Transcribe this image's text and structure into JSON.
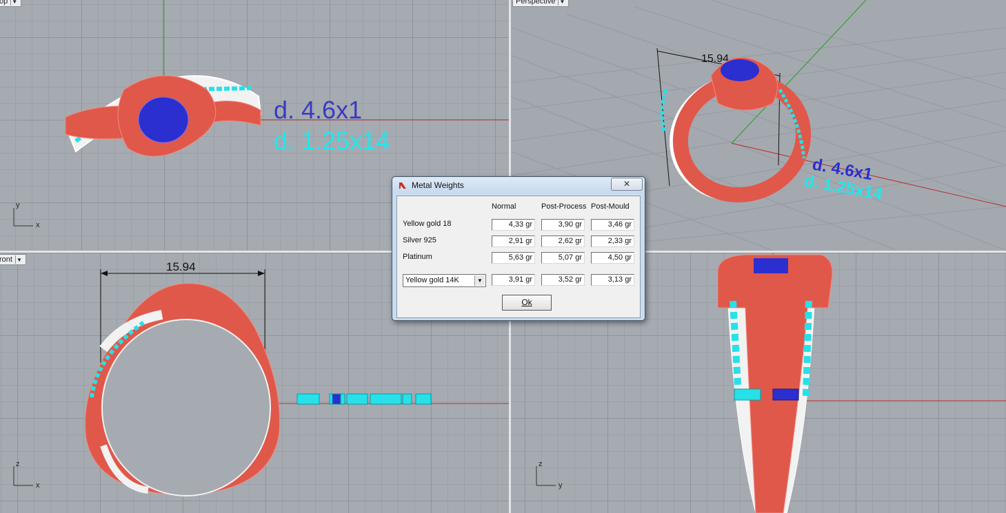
{
  "viewports": {
    "top": {
      "name": "op"
    },
    "perspective": {
      "name": "Perspective"
    },
    "front": {
      "name": "ront"
    },
    "right": {
      "name": ""
    }
  },
  "top_view": {
    "stone_label": "d. 4.6x1",
    "pave_label": "d. 1.25x14",
    "axis_y": "y",
    "axis_x": "x"
  },
  "perspective_view": {
    "dimension": "15.94"
  },
  "front_view": {
    "dimension": "15.94",
    "axis_z": "z",
    "axis_x": "x"
  },
  "right_view": {
    "axis_z": "z",
    "axis_y": "y"
  },
  "dialog": {
    "title": "Metal Weights",
    "close_glyph": "✕",
    "columns": [
      "Normal",
      "Post-Process",
      "Post-Mould"
    ],
    "rows": [
      {
        "label": "Yellow gold 18",
        "values": [
          "4,33 gr",
          "3,90 gr",
          "3,46 gr"
        ]
      },
      {
        "label": "Silver 925",
        "values": [
          "2,91 gr",
          "2,62 gr",
          "2,33 gr"
        ]
      },
      {
        "label": "Platinum",
        "values": [
          "5,63 gr",
          "5,07 gr",
          "4,50 gr"
        ]
      }
    ],
    "custom": {
      "selected": "Yellow gold 14K",
      "values": [
        "3,91 gr",
        "3,52 gr",
        "3,13 gr"
      ]
    },
    "ok_label": "Ok"
  },
  "colors": {
    "ring_metal": "#e0584a",
    "center_stone": "#2b2fd0",
    "pave_stones": "#27e0e8",
    "label_blue": "#3a3ac0",
    "label_cyan": "#22e6ee"
  }
}
